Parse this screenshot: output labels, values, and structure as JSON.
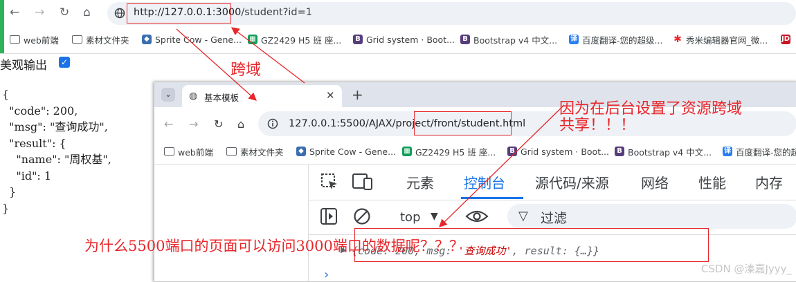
{
  "back_browser": {
    "url_highlight": "http://127.0.0.1:3000",
    "url_rest": "/student?id=1",
    "bookmarks": [
      {
        "label": "web前端",
        "icon": "folder-icon",
        "color": "#5f6368"
      },
      {
        "label": "素材文件夹",
        "icon": "folder-icon",
        "color": "#5f6368"
      },
      {
        "label": "Sprite Cow - Gene...",
        "icon": "sprite-cow-icon",
        "color": "#3a6fb0"
      },
      {
        "label": "GZ2429 H5 班 座...",
        "icon": "sheets-icon",
        "color": "#0f9d58"
      },
      {
        "label": "Grid system · Boot...",
        "icon": "bootstrap-icon",
        "color": "#563d7c"
      },
      {
        "label": "Bootstrap v4 中文...",
        "icon": "bootstrap-icon",
        "color": "#563d7c"
      },
      {
        "label": "百度翻译-您的超级...",
        "icon": "translate-icon",
        "color": "#2a7ff3"
      },
      {
        "label": "秀米编辑器官网_微...",
        "icon": "xiumi-icon",
        "color": "#e8262a"
      },
      {
        "label": "JD",
        "icon": "jd-icon",
        "color": "#c81623"
      }
    ],
    "beauty_label": "美观输出",
    "beauty_checked": true,
    "json_output": "{\n  \"code\": 200,\n  \"msg\": \"查询成功\",\n  \"result\": {\n    \"name\": \"周权基\",\n    \"id\": 1\n  }\n}"
  },
  "front_browser": {
    "tab_title": "基本模板",
    "url": "127.0.0.1:5500/AJAX/project/front/student.html",
    "bookmarks": [
      {
        "label": "web前端",
        "icon": "folder-icon",
        "color": "#5f6368"
      },
      {
        "label": "素材文件夹",
        "icon": "folder-icon",
        "color": "#5f6368"
      },
      {
        "label": "Sprite Cow - Gene...",
        "icon": "sprite-cow-icon",
        "color": "#3a6fb0"
      },
      {
        "label": "GZ2429 H5 班 座...",
        "icon": "sheets-icon",
        "color": "#0f9d58"
      },
      {
        "label": "Grid system · Boot...",
        "icon": "bootstrap-icon",
        "color": "#563d7c"
      },
      {
        "label": "Bootstrap v4 中文...",
        "icon": "bootstrap-icon",
        "color": "#563d7c"
      },
      {
        "label": "百度翻译-您的超级",
        "icon": "translate-icon",
        "color": "#2a7ff3"
      }
    ],
    "devtools": {
      "tabs": [
        "元素",
        "控制台",
        "源代码/来源",
        "网络",
        "性能",
        "内存"
      ],
      "active_tab": "控制台",
      "context_select": "top",
      "filter_placeholder": "过滤",
      "console_prefix": "{code: 200, msg: ",
      "console_msg": "'查询成功'",
      "console_suffix": ", result: {…}}"
    }
  },
  "annotations": {
    "cross_origin": "跨域",
    "cors_line1": "因为在后台设置了资源跨域",
    "cors_line2": "共享！！！",
    "question": "为什么5500端口的页面可以访问3000端口的数据呢？？？"
  },
  "watermark": "CSDN @溱嘉Jyyy_"
}
